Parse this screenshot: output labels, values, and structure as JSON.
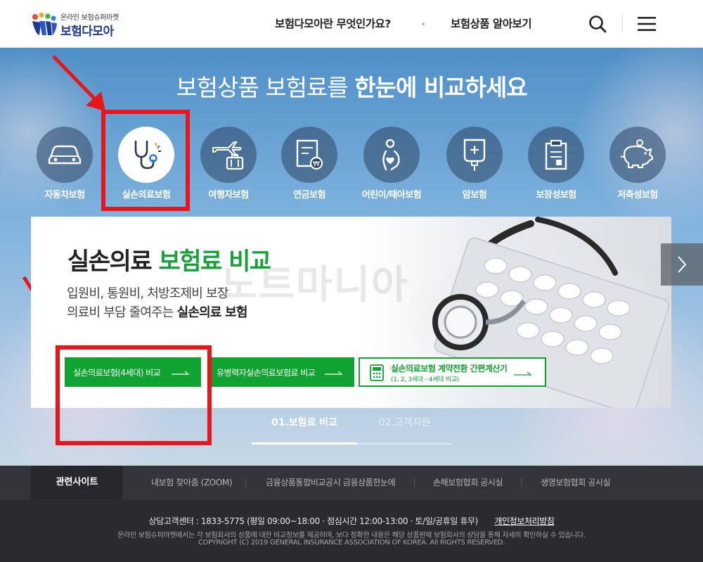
{
  "header": {
    "logo_sub": "온라인 보험슈퍼마켓",
    "logo_main": "보험다모아",
    "nav": [
      "보험다모아란 무엇인가요?",
      "보험상품 알아보기"
    ],
    "icons": [
      "search-icon",
      "menu-icon"
    ]
  },
  "hero": {
    "title_light": "보험상품 보험료를",
    "title_bold": "한눈에 비교하세요",
    "categories": [
      {
        "label": "자동차보험",
        "icon": "car-icon"
      },
      {
        "label": "실손의료보험",
        "icon": "stethoscope-icon",
        "active": true
      },
      {
        "label": "여행자보험",
        "icon": "airplane-luggage-icon"
      },
      {
        "label": "연금보험",
        "icon": "pension-document-icon"
      },
      {
        "label": "어린이/태아보험",
        "icon": "child-icon"
      },
      {
        "label": "암보험",
        "icon": "iv-bag-icon"
      },
      {
        "label": "보장성보험",
        "icon": "clipboard-icon"
      },
      {
        "label": "저축성보험",
        "icon": "piggy-bank-icon"
      }
    ]
  },
  "panel": {
    "title_dark": "실손의료",
    "title_green": "보험료 비교",
    "desc_line1": "입원비, 통원비, 처방조제비 보장",
    "desc_line2_prefix": "의료비 부담 줄여주는",
    "desc_line2_bold": "실손의료 보험",
    "watermark": "노트마니아",
    "buttons": [
      {
        "label": "실손의료보험(4세대) 비교"
      },
      {
        "label": "유병력자실손의료보험료 비교"
      }
    ],
    "calc_button": {
      "label": "실손의료보험 계약전환 간편계산기",
      "sub": "(1, 2, 3세대 - 4세대 비교)"
    }
  },
  "tabs": [
    "01.보험료 비교",
    "02.고객지원"
  ],
  "related": {
    "title": "관련사이트",
    "links": [
      "내보험 찾아줌 (ZOOM)",
      "금융상품통합비교공시 금융상품한눈에",
      "손해보험협회 공시실",
      "생명보험협회 공시실"
    ]
  },
  "footer": {
    "contact": "상담고객센터 : 1833-5775 (평일 09:00~18:00  ·  점심시간 12:00-13:00  ·  토/일/공휴일 휴무)",
    "privacy": "개인정보처리방침",
    "notice": "온라인 보험슈퍼마켓에서는 각 보험회사의 상품에 대한 비교정보를 제공하며, 보다 정확한 내용은 해당 상품판매 보험회사의 상담을 통해 자세히 확인하실 수 있습니다.",
    "copyright": "COPYRIGHT (C) 2019 GENERAL INSURANCE ASSOCIATION OF KOREA. All RIGHTS RESERVED."
  },
  "colors": {
    "brand_green": "#11a332",
    "highlight_red": "#e8161b",
    "logo_navy": "#1d3a8f"
  }
}
